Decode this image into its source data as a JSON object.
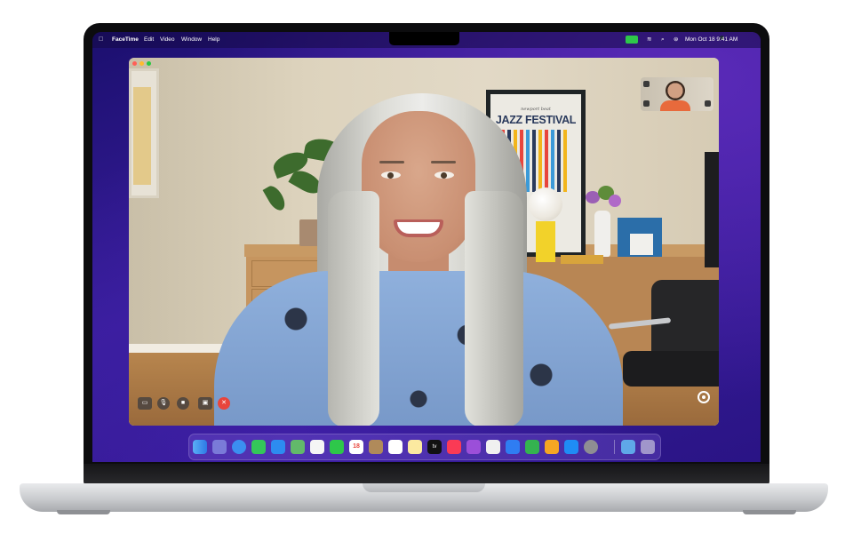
{
  "menubar": {
    "app_name": "FaceTime",
    "menus": [
      "Edit",
      "Video",
      "Window",
      "Help"
    ],
    "datetime": "Mon Oct 18  9:41 AM"
  },
  "poster": {
    "script": "newport beat",
    "title": "JAZZ FESTIVAL"
  },
  "dock": {
    "calendar_day": "18",
    "tv_label": "tv",
    "icons": [
      "finder-icon",
      "launchpad-icon",
      "safari-icon",
      "messages-icon",
      "mail-icon",
      "maps-icon",
      "photos-icon",
      "facetime-icon",
      "calendar-icon",
      "contacts-icon",
      "reminders-icon",
      "notes-icon",
      "apple-tv-icon",
      "music-icon",
      "podcasts-icon",
      "news-icon",
      "keynote-icon",
      "numbers-icon",
      "pages-icon",
      "app-store-icon",
      "system-preferences-icon",
      "downloads-folder-icon",
      "trash-icon"
    ]
  },
  "controls": {
    "end_symbol": "✕"
  },
  "colors": {
    "end_call": "#e8453c",
    "facetime_green": "#2ec74a",
    "wallpaper": "#2a1485"
  }
}
